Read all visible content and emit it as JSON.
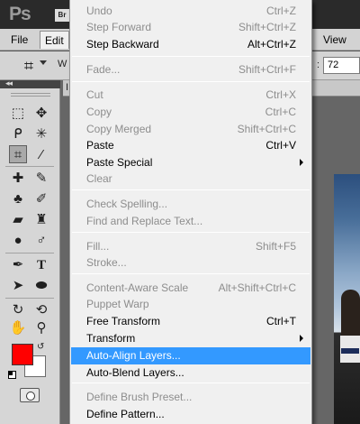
{
  "app": {
    "logo_text": "Ps",
    "bridge_badge": "Br"
  },
  "menubar": {
    "file": "File",
    "edit": "Edit",
    "view": "View"
  },
  "options": {
    "width_label": "W",
    "resolution_colon": ":",
    "resolution_value": "72"
  },
  "toolbox": {
    "collapse_label": "◂◂"
  },
  "document": {
    "tab_label": "I"
  },
  "colors": {
    "foreground": "#ff0000",
    "background": "#ffffff",
    "menu_highlight": "#3399ff"
  },
  "edit_menu": {
    "items": [
      {
        "label": "Undo",
        "shortcut": "Ctrl+Z",
        "enabled": false
      },
      {
        "label": "Step Forward",
        "shortcut": "Shift+Ctrl+Z",
        "enabled": false
      },
      {
        "label": "Step Backward",
        "shortcut": "Alt+Ctrl+Z",
        "enabled": true
      },
      {
        "label": "Fade...",
        "shortcut": "Shift+Ctrl+F",
        "enabled": false
      },
      {
        "label": "Cut",
        "shortcut": "Ctrl+X",
        "enabled": false
      },
      {
        "label": "Copy",
        "shortcut": "Ctrl+C",
        "enabled": false
      },
      {
        "label": "Copy Merged",
        "shortcut": "Shift+Ctrl+C",
        "enabled": false
      },
      {
        "label": "Paste",
        "shortcut": "Ctrl+V",
        "enabled": true
      },
      {
        "label": "Paste Special",
        "shortcut": "",
        "enabled": true,
        "submenu": true
      },
      {
        "label": "Clear",
        "shortcut": "",
        "enabled": false
      },
      {
        "label": "Check Spelling...",
        "shortcut": "",
        "enabled": false
      },
      {
        "label": "Find and Replace Text...",
        "shortcut": "",
        "enabled": false
      },
      {
        "label": "Fill...",
        "shortcut": "Shift+F5",
        "enabled": false
      },
      {
        "label": "Stroke...",
        "shortcut": "",
        "enabled": false
      },
      {
        "label": "Content-Aware Scale",
        "shortcut": "Alt+Shift+Ctrl+C",
        "enabled": false
      },
      {
        "label": "Puppet Warp",
        "shortcut": "",
        "enabled": false
      },
      {
        "label": "Free Transform",
        "shortcut": "Ctrl+T",
        "enabled": true
      },
      {
        "label": "Transform",
        "shortcut": "",
        "enabled": true,
        "submenu": true
      },
      {
        "label": "Auto-Align Layers...",
        "shortcut": "",
        "enabled": true,
        "highlighted": true
      },
      {
        "label": "Auto-Blend Layers...",
        "shortcut": "",
        "enabled": true
      },
      {
        "label": "Define Brush Preset...",
        "shortcut": "",
        "enabled": false
      },
      {
        "label": "Define Pattern...",
        "shortcut": "",
        "enabled": true
      }
    ]
  }
}
